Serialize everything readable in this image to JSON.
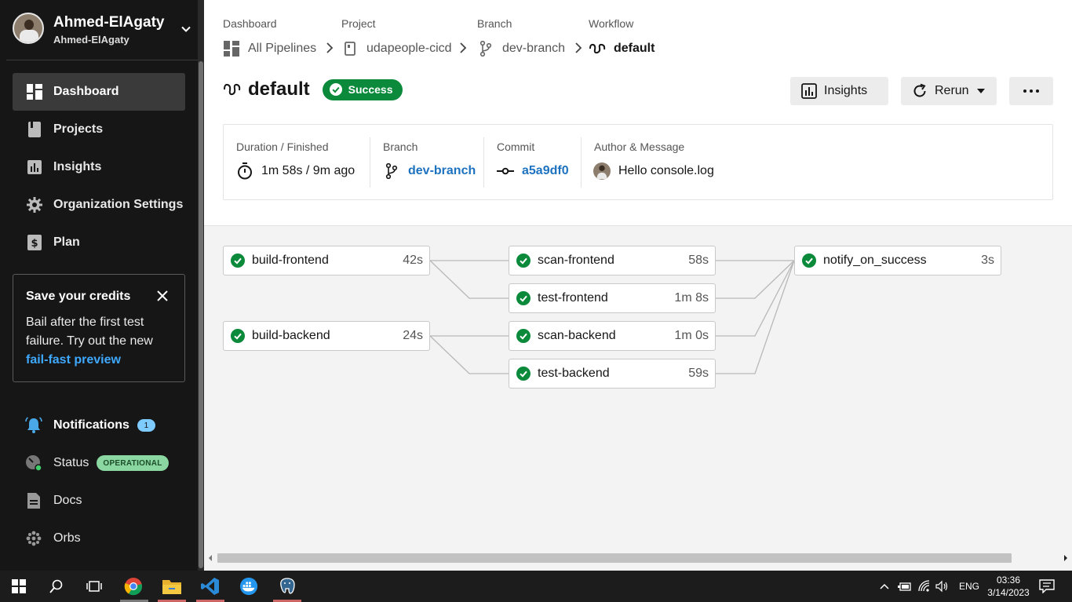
{
  "sidebar": {
    "user": {
      "display_name": "Ahmed-ElAgaty",
      "org_name": "Ahmed-ElAgaty"
    },
    "nav": [
      {
        "label": "Dashboard",
        "icon": "dashboard-icon",
        "active": true
      },
      {
        "label": "Projects",
        "icon": "book-icon"
      },
      {
        "label": "Insights",
        "icon": "chart-icon"
      },
      {
        "label": "Organization Settings",
        "icon": "gear-icon"
      },
      {
        "label": "Plan",
        "icon": "dollar-icon"
      }
    ],
    "promo": {
      "title": "Save your credits",
      "body": "Bail after the first test failure. Try out the new ",
      "link": "fail-fast preview"
    },
    "bottom": {
      "notifications": {
        "label": "Notifications",
        "count": "1"
      },
      "status": {
        "label": "Status",
        "badge": "OPERATIONAL"
      },
      "docs": {
        "label": "Docs"
      },
      "orbs": {
        "label": "Orbs"
      }
    }
  },
  "breadcrumb": {
    "dashboard": {
      "caption": "Dashboard",
      "value": "All Pipelines"
    },
    "project": {
      "caption": "Project",
      "value": "udapeople-cicd"
    },
    "branch": {
      "caption": "Branch",
      "value": "dev-branch"
    },
    "workflow": {
      "caption": "Workflow",
      "value": "default"
    }
  },
  "workflow": {
    "name": "default",
    "status": "Success",
    "buttons": {
      "insights": "Insights",
      "rerun": "Rerun"
    }
  },
  "meta": {
    "duration": {
      "caption": "Duration / Finished",
      "value": "1m 58s / 9m ago"
    },
    "branch": {
      "caption": "Branch",
      "value": "dev-branch"
    },
    "commit": {
      "caption": "Commit",
      "value": "a5a9df0"
    },
    "author": {
      "caption": "Author & Message",
      "value": "Hello console.log"
    }
  },
  "jobs": [
    {
      "name": "build-frontend",
      "duration": "42s"
    },
    {
      "name": "build-backend",
      "duration": "24s"
    },
    {
      "name": "scan-frontend",
      "duration": "58s"
    },
    {
      "name": "test-frontend",
      "duration": "1m 8s"
    },
    {
      "name": "scan-backend",
      "duration": "1m 0s"
    },
    {
      "name": "test-backend",
      "duration": "59s"
    },
    {
      "name": "notify_on_success",
      "duration": "3s"
    }
  ],
  "taskbar": {
    "language": "ENG",
    "time": "03:36",
    "date": "3/14/2023"
  },
  "colors": {
    "sidebar_bg": "#161616",
    "success": "#0a8a3a",
    "link": "#1d72c0",
    "promo_link": "#3fa9ff"
  }
}
